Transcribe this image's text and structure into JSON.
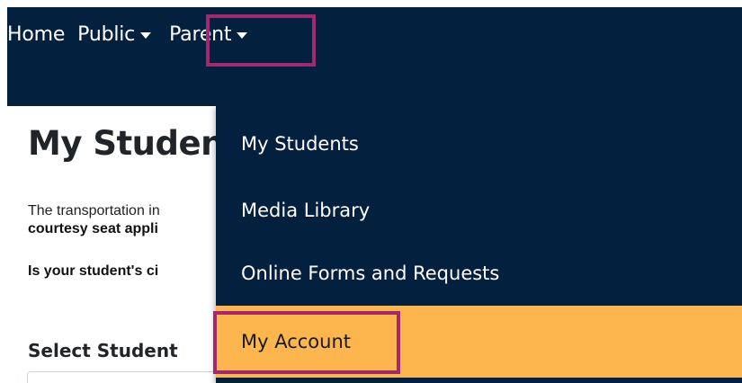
{
  "nav": {
    "home": "Home",
    "public": "Public",
    "parent": "Parent"
  },
  "dropdown": {
    "items": [
      {
        "label": "My Students"
      },
      {
        "label": "Media Library"
      },
      {
        "label": "Online Forms and Requests"
      },
      {
        "label": "My Account"
      }
    ]
  },
  "page": {
    "title": "My Studen",
    "line1": "The transportation in",
    "line2": "courtesy seat appli",
    "line3": "Is your student's ci",
    "select_label": "Select Student"
  },
  "colors": {
    "nav_bg": "#03213f",
    "highlight_border": "#a4286f",
    "active_item_bg": "#fdb54e"
  }
}
